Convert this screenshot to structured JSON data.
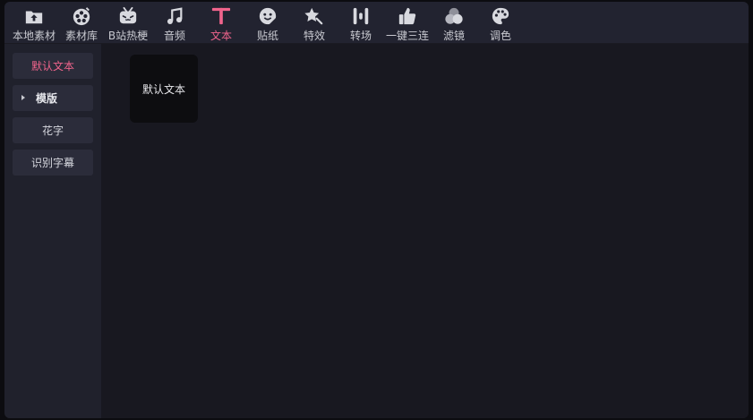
{
  "toolbar": {
    "tabs": [
      {
        "label": "本地素材",
        "icon": "upload-folder-icon"
      },
      {
        "label": "素材库",
        "icon": "film-reel-icon"
      },
      {
        "label": "B站热梗",
        "icon": "bilibili-tv-icon"
      },
      {
        "label": "音频",
        "icon": "music-note-icon"
      },
      {
        "label": "文本",
        "icon": "text-t-icon",
        "active": true
      },
      {
        "label": "贴纸",
        "icon": "sticker-smile-icon"
      },
      {
        "label": "特效",
        "icon": "sparkle-star-icon"
      },
      {
        "label": "转场",
        "icon": "transition-bars-icon"
      },
      {
        "label": "一键三连",
        "icon": "thumbs-up-icon"
      },
      {
        "label": "滤镜",
        "icon": "filter-circles-icon"
      },
      {
        "label": "调色",
        "icon": "palette-icon"
      }
    ]
  },
  "sidebar": {
    "items": [
      {
        "label": "默认文本",
        "active": true
      },
      {
        "label": "模版",
        "expandable": true
      },
      {
        "label": "花字"
      },
      {
        "label": "识别字幕"
      }
    ]
  },
  "main": {
    "presets": [
      {
        "label": "默认文本"
      }
    ]
  },
  "colors": {
    "accent": "#f0648c",
    "toolbar_bg": "#222330",
    "sidebar_bg": "#20212c",
    "main_bg": "#181820",
    "icon": "#d8d9df"
  }
}
